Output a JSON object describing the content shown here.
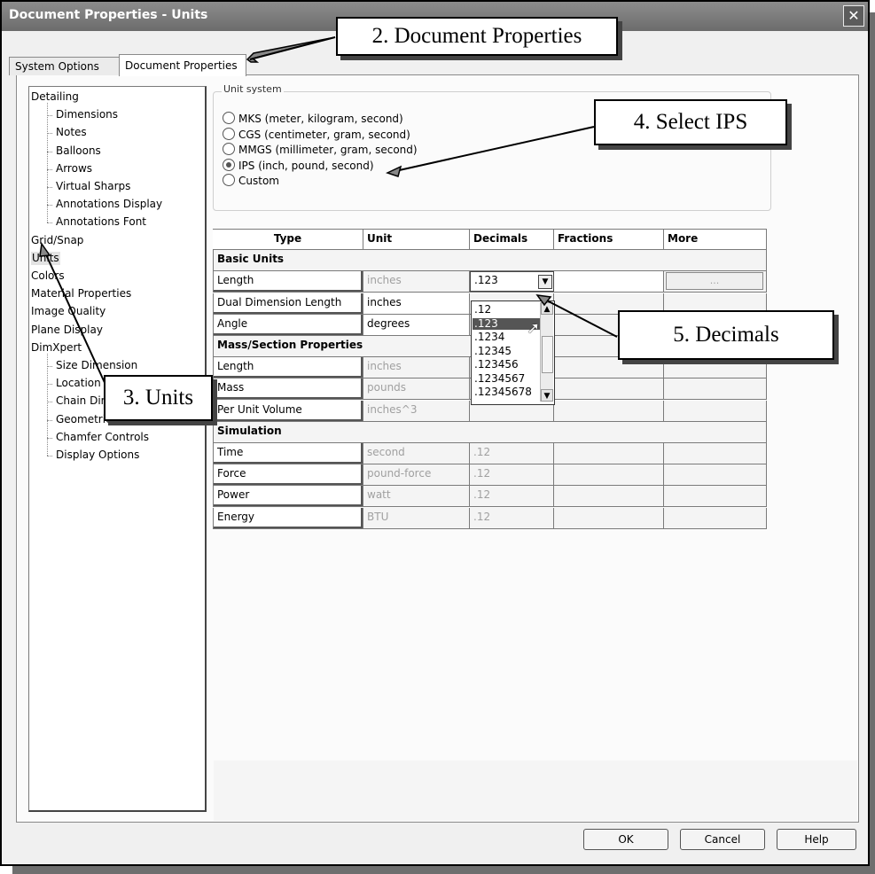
{
  "window": {
    "title": "Document Properties - Units",
    "close_glyph": "✕"
  },
  "tabs": [
    {
      "label": "System Options",
      "active": false
    },
    {
      "label": "Document Properties",
      "active": true
    }
  ],
  "tree": {
    "items": [
      {
        "label": "Detailing",
        "level": 0
      },
      {
        "label": "Dimensions",
        "level": 1
      },
      {
        "label": "Notes",
        "level": 1
      },
      {
        "label": "Balloons",
        "level": 1
      },
      {
        "label": "Arrows",
        "level": 1
      },
      {
        "label": "Virtual Sharps",
        "level": 1
      },
      {
        "label": "Annotations Display",
        "level": 1
      },
      {
        "label": "Annotations Font",
        "level": 1
      },
      {
        "label": "Grid/Snap",
        "level": 0
      },
      {
        "label": "Units",
        "level": 0,
        "selected": true
      },
      {
        "label": "Colors",
        "level": 0
      },
      {
        "label": "Material Properties",
        "level": 0
      },
      {
        "label": "Image Quality",
        "level": 0
      },
      {
        "label": "Plane Display",
        "level": 0
      },
      {
        "label": "DimXpert",
        "level": 0
      },
      {
        "label": "Size Dimension",
        "level": 1
      },
      {
        "label": "Location Dimension",
        "level": 1
      },
      {
        "label": "Chain Dimension",
        "level": 1
      },
      {
        "label": "Geometric Tolerance",
        "level": 1
      },
      {
        "label": "Chamfer Controls",
        "level": 1
      },
      {
        "label": "Display Options",
        "level": 1
      }
    ]
  },
  "unit_system": {
    "legend": "Unit system",
    "options": [
      {
        "label": "MKS  (meter, kilogram, second)",
        "selected": false
      },
      {
        "label": "CGS  (centimeter, gram, second)",
        "selected": false
      },
      {
        "label": "MMGS (millimeter, gram, second)",
        "selected": false
      },
      {
        "label": "IPS  (inch, pound, second)",
        "selected": true
      },
      {
        "label": "Custom",
        "selected": false
      }
    ]
  },
  "units_table": {
    "headers": [
      "Type",
      "Unit",
      "Decimals",
      "Fractions",
      "More"
    ],
    "sections": [
      {
        "title": "Basic Units",
        "rows": [
          {
            "type": "Length",
            "unit": "inches",
            "decimals": ".123",
            "more": "..."
          },
          {
            "type": "Dual Dimension Length",
            "unit": "inches",
            "decimals": ""
          },
          {
            "type": "Angle",
            "unit": "degrees",
            "decimals": ""
          }
        ]
      },
      {
        "title": "Mass/Section Properties",
        "rows": [
          {
            "type": "Length",
            "unit": "inches",
            "decimals": ""
          },
          {
            "type": "Mass",
            "unit": "pounds",
            "decimals": ""
          },
          {
            "type": "Per Unit Volume",
            "unit": "inches^3",
            "decimals": ""
          }
        ]
      },
      {
        "title": "Simulation",
        "rows": [
          {
            "type": "Time",
            "unit": "second",
            "decimals": ".12"
          },
          {
            "type": "Force",
            "unit": "pound-force",
            "decimals": ".12"
          },
          {
            "type": "Power",
            "unit": "watt",
            "decimals": ".12"
          },
          {
            "type": "Energy",
            "unit": "BTU",
            "decimals": ".12"
          }
        ]
      }
    ]
  },
  "decimals_dropdown": {
    "current": ".123",
    "options": [
      ".12",
      ".123",
      ".1234",
      ".12345",
      ".123456",
      ".1234567",
      ".12345678"
    ],
    "highlighted": ".123"
  },
  "buttons": {
    "ok": "OK",
    "cancel": "Cancel",
    "help": "Help"
  },
  "callouts": {
    "doc_props": "2. Document Properties",
    "units": "3. Units",
    "select_ips": "4. Select IPS",
    "decimals": "5. Decimals"
  }
}
